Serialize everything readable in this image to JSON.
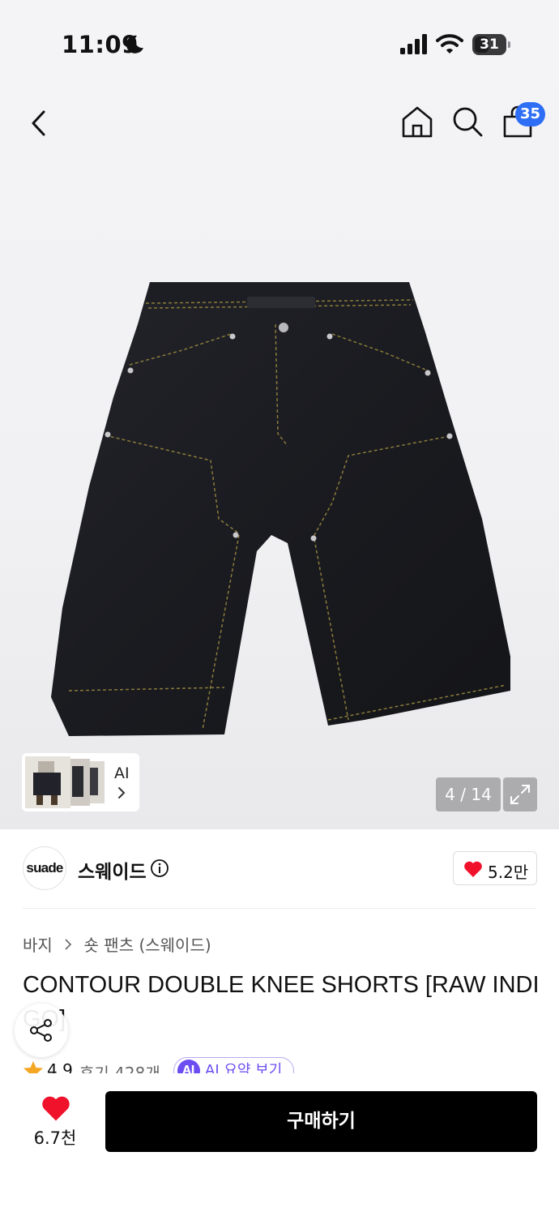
{
  "status_bar": {
    "time": "11:09",
    "battery": "31"
  },
  "header": {
    "cart_count": "35",
    "icons": [
      "back-icon",
      "home-icon",
      "search-icon",
      "cart-icon"
    ]
  },
  "gallery": {
    "thumb_label": "AI",
    "counter": "4 / 14"
  },
  "brand": {
    "logo_text": "suade",
    "name": "스웨이드",
    "like_count": "5.2만"
  },
  "breadcrumb": {
    "category": "바지",
    "subcategory": "숏 팬츠 (스웨이드)"
  },
  "product": {
    "title": "CONTOUR DOUBLE KNEE SHORTS [RAW INDIGO]",
    "rating": "4.9",
    "reviews": "후기 428개",
    "ai_badge": "AI",
    "ai_summary": "AI 요약 보기"
  },
  "bottom_bar": {
    "like_count": "6.7천",
    "buy_label": "구매하기"
  },
  "colors": {
    "badge_blue": "#2d6ef5",
    "heart_red": "#f0112b",
    "ai_purple": "#6b4df2",
    "buy_button": "#000000"
  }
}
